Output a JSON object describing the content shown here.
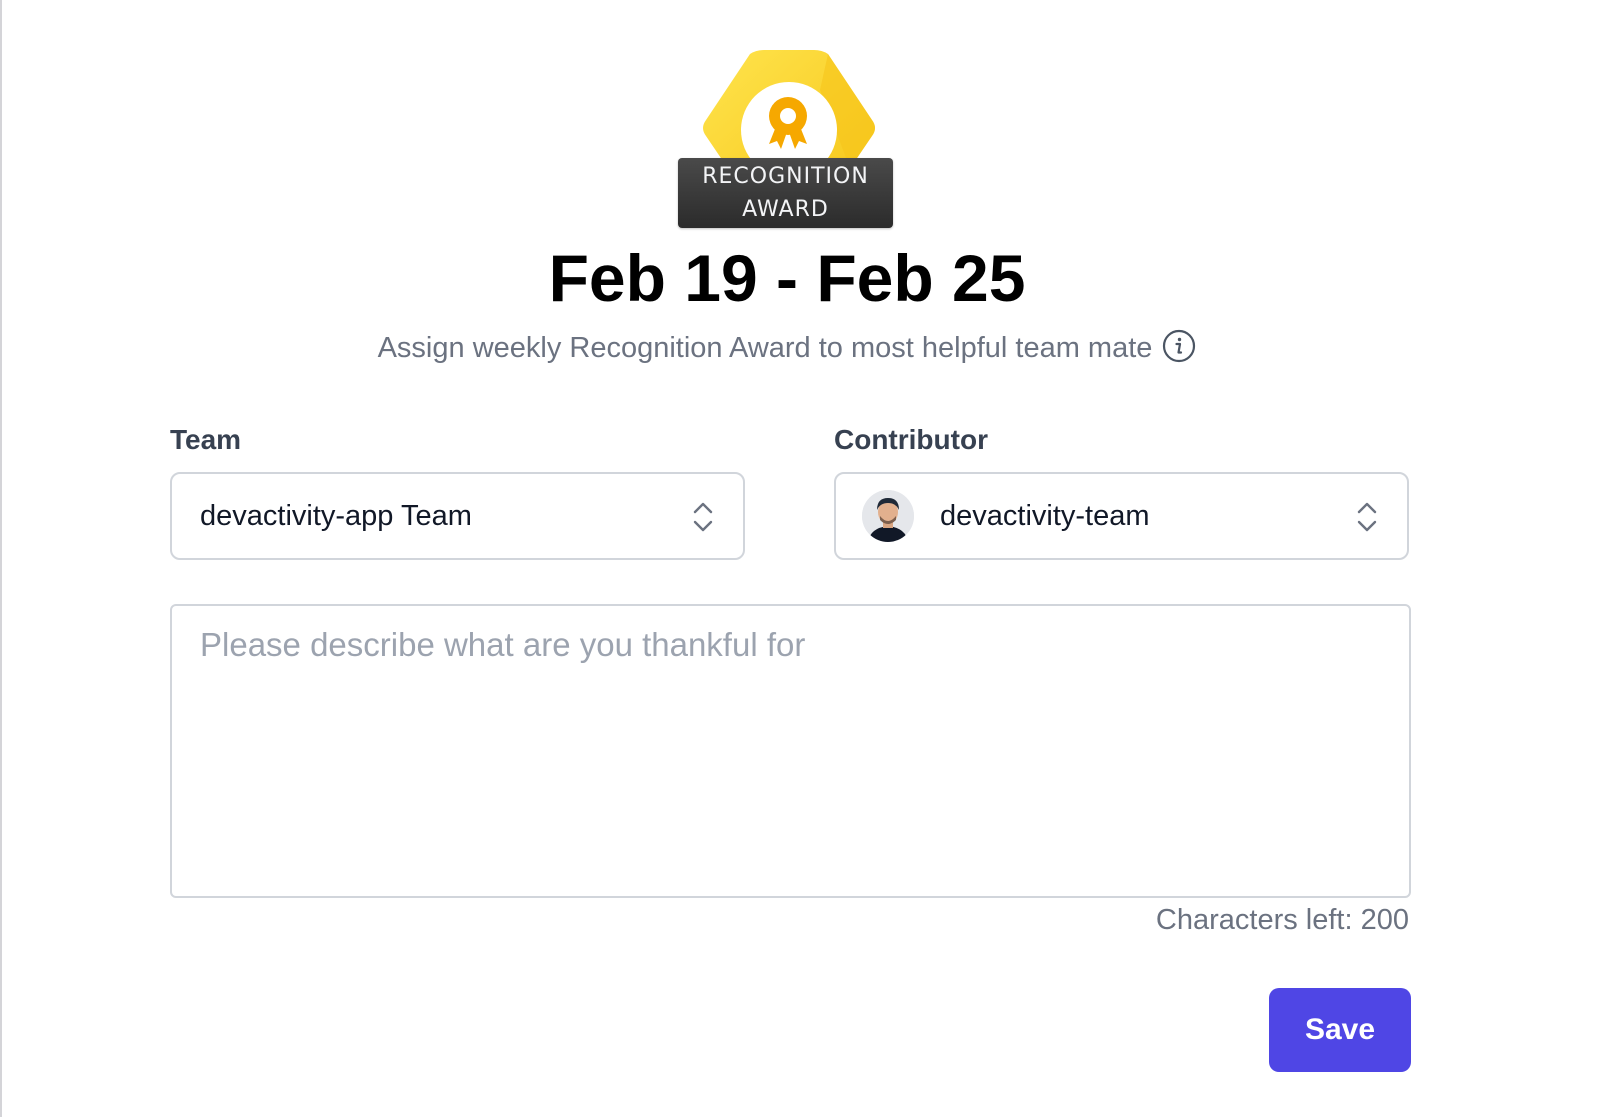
{
  "badge": {
    "label_line1": "RECOGNITION",
    "label_line2": "AWARD",
    "icon": "award-ribbon-icon",
    "colors": {
      "hex_primary": "#FCD535",
      "hex_shade": "#F5C518",
      "medal": "#F6A800"
    }
  },
  "header": {
    "date_range": "Feb 19 - Feb 25",
    "subtitle": "Assign weekly Recognition Award to most helpful team mate",
    "info_icon": "info-icon"
  },
  "team": {
    "label": "Team",
    "value": "devactivity-app Team"
  },
  "contributor": {
    "label": "Contributor",
    "value": "devactivity-team"
  },
  "message": {
    "placeholder": "Please describe what are you thankful for",
    "chars_left": "Characters left: 200"
  },
  "actions": {
    "save_label": "Save",
    "accent": "#4F46E5"
  }
}
